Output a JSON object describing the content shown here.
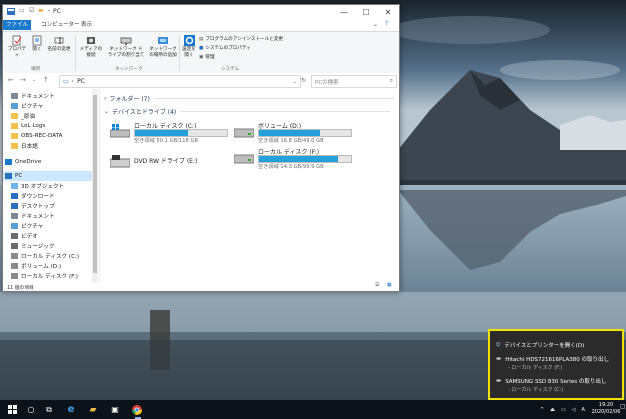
{
  "window": {
    "title": "PC",
    "min_glyph": "—",
    "max_glyph": "☐",
    "close_glyph": "✕"
  },
  "ribbon_tabs": [
    "ファイル",
    "コンピューター",
    "表示"
  ],
  "ribbon": {
    "properties": "プロパティ",
    "open": "開く",
    "rename": "名前の変更",
    "access_media": "メディアの接続",
    "map_drive": "ネットワーク ドライブの割り当て",
    "add_location": "ネットワークの場所の追加",
    "open_settings": "設定を開く",
    "uninstall": "プログラムのアンインストールと変更",
    "sys_props": "システムのプロパティ",
    "manage": "管理",
    "group_location": "場所",
    "group_network": "ネットワーク",
    "group_system": "システム"
  },
  "address": {
    "path": "PC",
    "search_placeholder": "PCの検索",
    "back": "←",
    "forward": "→",
    "recent": "⌄",
    "up": "↑",
    "refresh": "↻"
  },
  "nav": [
    {
      "label": "ドキュメント",
      "icon": "documents-icon"
    },
    {
      "label": "ピクチャ",
      "icon": "pictures-icon"
    },
    {
      "label": "_原油",
      "icon": "folder-icon"
    },
    {
      "label": "LoL Logs",
      "icon": "folder-icon"
    },
    {
      "label": "OBS-REC-DATA",
      "icon": "folder-icon"
    },
    {
      "label": "日本語",
      "icon": "folder-icon"
    },
    {
      "label": "OneDrive",
      "icon": "cloud-icon"
    },
    {
      "label": "PC",
      "icon": "pc-icon"
    },
    {
      "label": "3D オブジェクト",
      "icon": "cube-icon"
    },
    {
      "label": "ダウンロード",
      "icon": "download-icon"
    },
    {
      "label": "デスクトップ",
      "icon": "desktop-icon"
    },
    {
      "label": "ドキュメント",
      "icon": "documents-icon"
    },
    {
      "label": "ピクチャ",
      "icon": "pictures-icon"
    },
    {
      "label": "ビデオ",
      "icon": "video-icon"
    },
    {
      "label": "ミュージック",
      "icon": "music-icon"
    },
    {
      "label": "ローカル ディスク (C:)",
      "icon": "drive-icon"
    },
    {
      "label": "ボリューム (D:)",
      "icon": "drive-icon"
    },
    {
      "label": "ローカル ディスク (F:)",
      "icon": "drive-icon"
    }
  ],
  "sections": {
    "folders": "フォルダー (7)",
    "drives": "デバイスとドライブ (4)"
  },
  "drives": [
    {
      "name": "ローカル ディスク (C:)",
      "space": "空き領域 50.1 GB/118 GB",
      "used_fraction": 0.58,
      "icon": "windows-drive-icon"
    },
    {
      "name": "ボリューム (D:)",
      "space": "空き領域 16.8 GB/49.0 GB",
      "used_fraction": 0.66,
      "icon": "drive-icon"
    },
    {
      "name": "DVD RW ドライブ (E:)",
      "space": "",
      "used_fraction": null,
      "icon": "dvd-drive-icon"
    },
    {
      "name": "ローカル ディスク (F:)",
      "space": "空き領域 14.3 GB/99.9 GB",
      "used_fraction": 0.86,
      "icon": "drive-icon"
    }
  ],
  "status": {
    "count": "11 個の項目"
  },
  "popup": {
    "header": "デバイスとプリンターを開く(D)",
    "items": [
      {
        "title": "Hitachi HDS721616PLA380 の取り出し",
        "sub": "- ローカル ディスク (F:)"
      },
      {
        "title": "SAMSUNG SSD 830 Series の取り出し",
        "sub": "- ローカル ディスク (C:)"
      }
    ]
  },
  "taskbar": {
    "ime": "A",
    "time": "19:20",
    "date": "2020/02/06"
  },
  "colors": {
    "accent": "#1979ca",
    "drive_bar": "#26a0da",
    "highlight": "#f2e20a"
  }
}
